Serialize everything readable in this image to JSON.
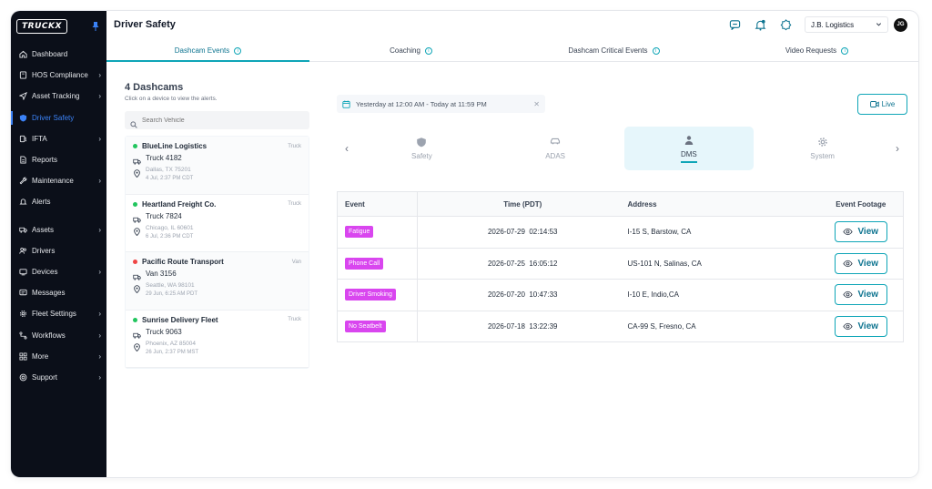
{
  "sidebar": {
    "logo_text": "TRUCKX",
    "items": [
      {
        "label": "Dashboard",
        "icon": "home-icon",
        "chevron": false,
        "active": false
      },
      {
        "label": "HOS Compliance",
        "icon": "book-icon",
        "chevron": true,
        "active": false
      },
      {
        "label": "Asset Tracking",
        "icon": "send-icon",
        "chevron": true,
        "active": false
      },
      {
        "label": "Driver Safety",
        "icon": "shield-icon",
        "chevron": false,
        "active": true
      },
      {
        "label": "IFTA",
        "icon": "fuel-icon",
        "chevron": true,
        "active": false
      },
      {
        "label": "Reports",
        "icon": "document-icon",
        "chevron": false,
        "active": false
      },
      {
        "label": "Maintenance",
        "icon": "wrench-icon",
        "chevron": true,
        "active": false
      },
      {
        "label": "Alerts",
        "icon": "alert-icon",
        "chevron": false,
        "active": false
      },
      {
        "label": "Assets",
        "icon": "truck-icon",
        "chevron": true,
        "active": false
      },
      {
        "label": "Drivers",
        "icon": "users-icon",
        "chevron": false,
        "active": false
      },
      {
        "label": "Devices",
        "icon": "device-icon",
        "chevron": true,
        "active": false
      },
      {
        "label": "Messages",
        "icon": "message-icon",
        "chevron": false,
        "active": false
      },
      {
        "label": "Fleet Settings",
        "icon": "gear-icon",
        "chevron": true,
        "active": false
      },
      {
        "label": "Workflows",
        "icon": "workflow-icon",
        "chevron": true,
        "active": false
      },
      {
        "label": "More",
        "icon": "grid-icon",
        "chevron": true,
        "active": false
      },
      {
        "label": "Support",
        "icon": "support-icon",
        "chevron": true,
        "active": false
      }
    ]
  },
  "header": {
    "title": "Driver Safety",
    "org": "J.B. Logistics",
    "avatar_initials": "JG"
  },
  "tabs": [
    {
      "label": "Dashcam Events",
      "active": true
    },
    {
      "label": "Coaching",
      "active": false
    },
    {
      "label": "Dashcam Critical Events",
      "active": false
    },
    {
      "label": "Video Requests",
      "active": false
    }
  ],
  "devices": {
    "count_label": "4 Dashcams",
    "hint": "Click on a device to view the alerts.",
    "search_placeholder": "Search Vehicle",
    "items": [
      {
        "name": "BlueLine Logistics",
        "type": "Truck",
        "unit": "Truck 4182",
        "location": "Dallas, TX 75201",
        "time": "4 Jul, 2:37 PM CDT",
        "status_color": "#22c55e"
      },
      {
        "name": "Heartland Freight Co.",
        "type": "Truck",
        "unit": "Truck 7824",
        "location": "Chicago, IL 60601",
        "time": "6 Jul, 2:36 PM CDT",
        "status_color": "#22c55e"
      },
      {
        "name": "Pacific Route Transport",
        "type": "Van",
        "unit": "Van 3156",
        "location": "Seattle, WA 98101",
        "time": "29 Jun, 6:25 AM PDT",
        "status_color": "#ef4444"
      },
      {
        "name": "Sunrise Delivery Fleet",
        "type": "Truck",
        "unit": "Truck 9063",
        "location": "Phoenix, AZ 85004",
        "time": "26 Jun, 2:37 PM MST",
        "status_color": "#22c55e"
      }
    ]
  },
  "filter": {
    "date_range": "Yesterday at 12:00 AM - Today at 11:59 PM",
    "live_label": "Live"
  },
  "categories": [
    {
      "label": "Safety",
      "icon": "shield-icon",
      "active": false
    },
    {
      "label": "ADAS",
      "icon": "car-icon",
      "active": false
    },
    {
      "label": "DMS",
      "icon": "person-icon",
      "active": true
    },
    {
      "label": "System",
      "icon": "gear-icon",
      "active": false
    }
  ],
  "table": {
    "headers": [
      "Event",
      "Time (PDT)",
      "Address",
      "Event Footage"
    ],
    "view_label": "View",
    "rows": [
      {
        "event": "Fatigue",
        "time": "2026-07-29  02:14:53",
        "address": "I-15 S, Barstow, CA"
      },
      {
        "event": "Phone Call",
        "time": "2026-07-25  16:05:12",
        "address": "US-101 N, Salinas, CA"
      },
      {
        "event": "Driver Smoking",
        "time": "2026-07-20  10:47:33",
        "address": "I-10 E, Indio,CA"
      },
      {
        "event": "No Seatbelt",
        "time": "2026-07-18  13:22:39",
        "address": "CA-99 S, Fresno, CA"
      }
    ]
  },
  "colors": {
    "accent": "#0ea5b7",
    "sidebar_bg": "#0b0f19",
    "active_nav": "#3b82f6",
    "event_badge": "#d946ef"
  }
}
